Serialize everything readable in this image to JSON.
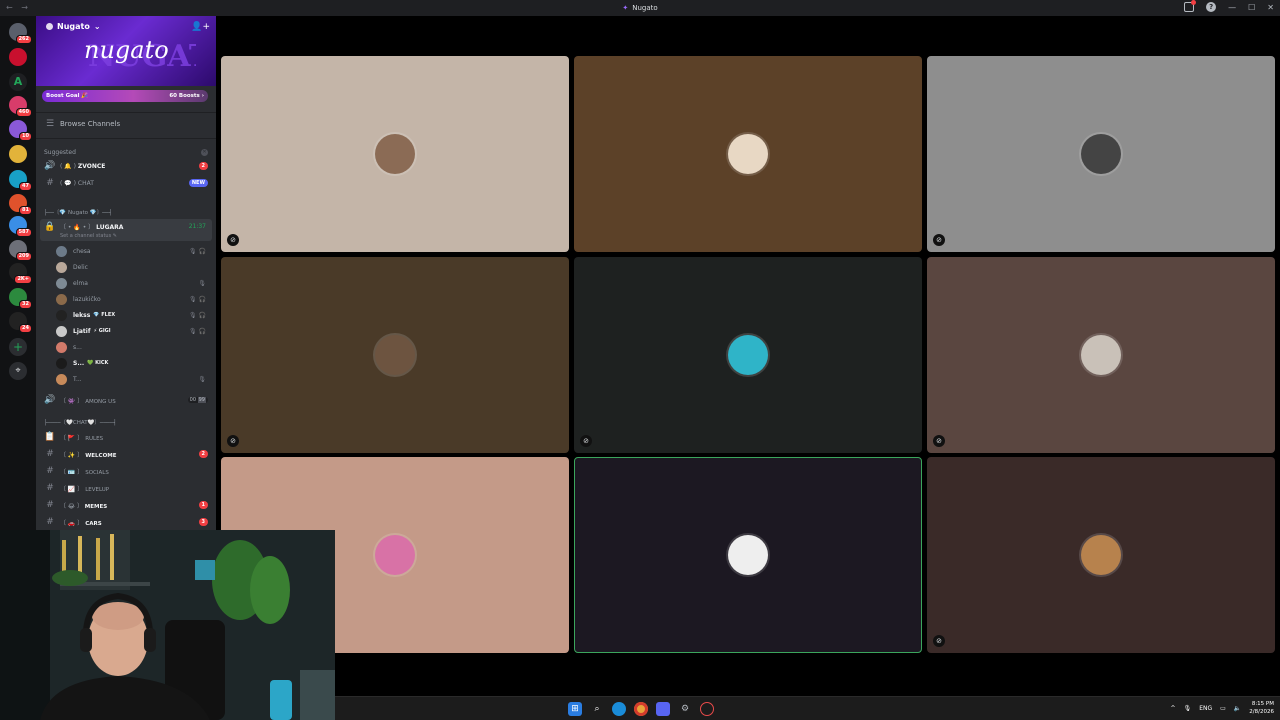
{
  "window": {
    "title": "Nugato",
    "nav": "← →"
  },
  "titlebar_icons": [
    "inbox-icon",
    "help-icon"
  ],
  "window_controls": [
    "—",
    "☐",
    "✕"
  ],
  "server_rail": [
    {
      "badge": "262",
      "color": "#5a5f6b"
    },
    {
      "badge": "",
      "color": "#c8102e"
    },
    {
      "badge": "",
      "color": "#1e1f22",
      "glyph": "A"
    },
    {
      "badge": "460",
      "color": "#d83c6a"
    },
    {
      "badge": "10",
      "color": "#8a59d8"
    },
    {
      "badge": "",
      "color": "#e2b33a"
    },
    {
      "badge": "47",
      "color": "#18a0c6"
    },
    {
      "badge": "81",
      "color": "#e0522c"
    },
    {
      "badge": "587",
      "color": "#3a8ee6"
    },
    {
      "badge": "209",
      "color": "#6d6f78"
    },
    {
      "badge": "2K+",
      "color": "#222"
    },
    {
      "badge": "32",
      "color": "#2c8a3e"
    },
    {
      "badge": "24",
      "color": "#222"
    }
  ],
  "server": {
    "name": "Nugato",
    "banner_text": "nugato"
  },
  "boost": {
    "label": "Boost Goal 🎉",
    "count": "60 Boosts ›"
  },
  "browse_channels": "Browse Channels",
  "suggested": {
    "label": "Suggested",
    "items": [
      {
        "icon": "🔊",
        "prefix": "( 🔔 )",
        "name": "ZVONCE",
        "badge": "2",
        "badge_type": "mention"
      },
      {
        "icon": "#",
        "prefix": "( 💬 )",
        "name": "CHAT",
        "badge": "NEW",
        "badge_type": "new"
      }
    ]
  },
  "category1": "├──〔💎 Nugato 💎〕──┤",
  "voice_channel": {
    "prefix": "〔 • 🔥 • 〕",
    "name": "LUGARA",
    "status": "Set a channel status ✎",
    "time": "21:37"
  },
  "voice_users": [
    {
      "name": "chesa",
      "color": "#6c7a89",
      "mic": "🎙 🎧"
    },
    {
      "name": "Delic",
      "color": "#b9a89a",
      "mic": ""
    },
    {
      "name": "elma",
      "color": "#7e8a94",
      "mic": "🎙"
    },
    {
      "name": "lazukičko",
      "color": "#8b6a4a",
      "mic": "🎙 🎧"
    },
    {
      "name": "lekss",
      "tag": "💎 FLEX",
      "color": "#222",
      "mic": "🎙 🎧"
    },
    {
      "name": "Ljatif",
      "tag": "⚡ GIGI",
      "color": "#c9c9c9",
      "mic": "🎙 🎧"
    },
    {
      "name": "s...",
      "color": "#d27a6a",
      "mic": ""
    },
    {
      "name": "S...",
      "tag": "💚 KICK",
      "color": "#1b1b1b",
      "mic": ""
    },
    {
      "name": "T...",
      "color": "#c78a5a",
      "mic": "🎙"
    }
  ],
  "among_us": {
    "prefix": "〔 👾 〕",
    "name": "AMONG US",
    "count": "00",
    "limit": "99"
  },
  "category2": "├────〔🤍CHAT🤍〕────┤",
  "channels": [
    {
      "icon": "📋",
      "prefix": "〔 🚩 〕",
      "name": "RULES",
      "badge": ""
    },
    {
      "icon": "#",
      "prefix": "〔 ✨ 〕",
      "name": "WELCOME",
      "badge": "2"
    },
    {
      "icon": "#",
      "prefix": "〔 🪪 〕",
      "name": "SOCIALS",
      "badge": ""
    },
    {
      "icon": "#",
      "prefix": "〔 📈 〕",
      "name": "LEVELUP",
      "badge": ""
    },
    {
      "icon": "#",
      "prefix": "〔 😂 〕",
      "name": "MEMES",
      "badge": "1"
    },
    {
      "icon": "#",
      "prefix": "〔 🚗 〕",
      "name": "CARS",
      "badge": "3"
    }
  ],
  "video_tiles": [
    {
      "bg": "#c4b5a8",
      "avatar": "#8b6b55",
      "muted": true,
      "active": false
    },
    {
      "bg": "#5c4128",
      "avatar": "#e8d8c4",
      "muted": false,
      "active": false
    },
    {
      "bg": "#8e8e8e",
      "avatar": "#444",
      "muted": true,
      "active": false
    },
    {
      "bg": "#4a3a28",
      "avatar": "#6d5440",
      "muted": true,
      "active": false
    },
    {
      "bg": "#1e2120",
      "avatar": "#2fb4c8",
      "muted": true,
      "active": false
    },
    {
      "bg": "#5a4640",
      "avatar": "#c9c1b8",
      "muted": true,
      "active": false
    },
    {
      "bg": "#c49a88",
      "avatar": "#d872a6",
      "muted": false,
      "active": false
    },
    {
      "bg": "#1c1822",
      "avatar": "#eeeeee",
      "muted": false,
      "active": true
    },
    {
      "bg": "#3a2a28",
      "avatar": "#b7824d",
      "muted": true,
      "active": false
    }
  ],
  "taskbar": {
    "apps": [
      "start-icon",
      "search-icon",
      "edge-icon",
      "chrome-icon",
      "discord-icon",
      "settings-icon",
      "app-icon"
    ],
    "lang": "ENG",
    "time": "8:15 PM",
    "date": "2/8/2026"
  }
}
